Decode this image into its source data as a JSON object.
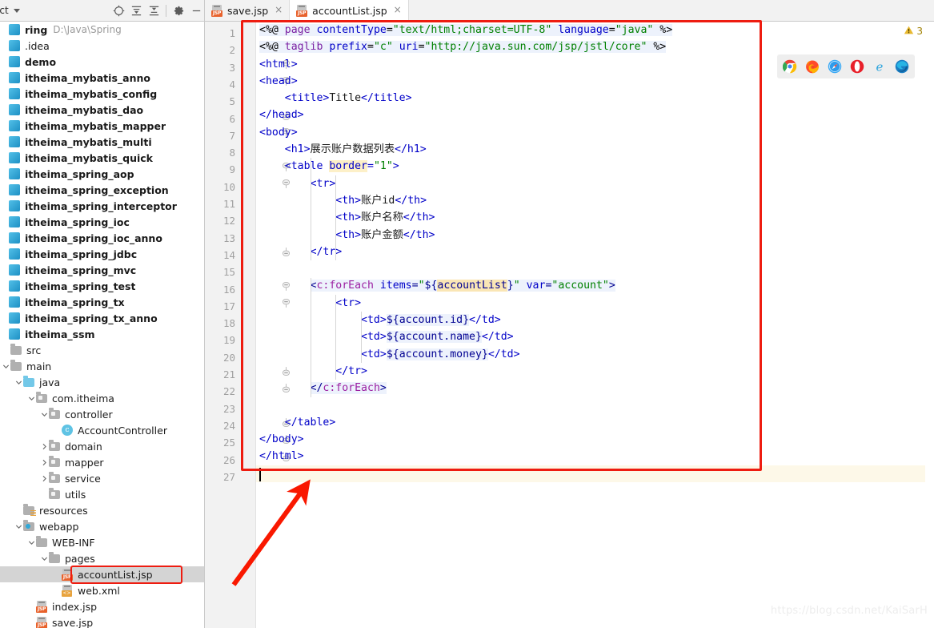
{
  "window": {
    "watermark": "https://blog.csdn.net/KaiSarH"
  },
  "project_panel": {
    "title": "ect",
    "toolbar": [
      {
        "name": "select-opened-file-icon",
        "label": "⊕"
      },
      {
        "name": "expand-all-icon",
        "label": "≣"
      },
      {
        "name": "collapse-all-icon",
        "label": "≡"
      },
      {
        "name": "settings-gear-icon",
        "label": "⚙"
      },
      {
        "name": "hide-panel-icon",
        "label": "—"
      }
    ],
    "tree": [
      {
        "depth": 0,
        "arrow": "none",
        "icon": "module",
        "label": "ring",
        "path": "D:\\Java\\Spring",
        "bold": true,
        "selected": false
      },
      {
        "depth": 0,
        "arrow": "none",
        "icon": "module",
        "label": ".idea",
        "path": "",
        "bold": false,
        "selected": false
      },
      {
        "depth": 0,
        "arrow": "none",
        "icon": "module",
        "label": "demo",
        "path": "",
        "bold": true,
        "selected": false
      },
      {
        "depth": 0,
        "arrow": "none",
        "icon": "module",
        "label": "itheima_mybatis_anno",
        "path": "",
        "bold": true,
        "selected": false
      },
      {
        "depth": 0,
        "arrow": "none",
        "icon": "module",
        "label": "itheima_mybatis_config",
        "path": "",
        "bold": true,
        "selected": false
      },
      {
        "depth": 0,
        "arrow": "none",
        "icon": "module",
        "label": "itheima_mybatis_dao",
        "path": "",
        "bold": true,
        "selected": false
      },
      {
        "depth": 0,
        "arrow": "none",
        "icon": "module",
        "label": "itheima_mybatis_mapper",
        "path": "",
        "bold": true,
        "selected": false
      },
      {
        "depth": 0,
        "arrow": "none",
        "icon": "module",
        "label": "itheima_mybatis_multi",
        "path": "",
        "bold": true,
        "selected": false
      },
      {
        "depth": 0,
        "arrow": "none",
        "icon": "module",
        "label": "itheima_mybatis_quick",
        "path": "",
        "bold": true,
        "selected": false
      },
      {
        "depth": 0,
        "arrow": "none",
        "icon": "module",
        "label": "itheima_spring_aop",
        "path": "",
        "bold": true,
        "selected": false
      },
      {
        "depth": 0,
        "arrow": "none",
        "icon": "module",
        "label": "itheima_spring_exception",
        "path": "",
        "bold": true,
        "selected": false
      },
      {
        "depth": 0,
        "arrow": "none",
        "icon": "module",
        "label": "itheima_spring_interceptor",
        "path": "",
        "bold": true,
        "selected": false
      },
      {
        "depth": 0,
        "arrow": "none",
        "icon": "module",
        "label": "itheima_spring_ioc",
        "path": "",
        "bold": true,
        "selected": false
      },
      {
        "depth": 0,
        "arrow": "none",
        "icon": "module",
        "label": "itheima_spring_ioc_anno",
        "path": "",
        "bold": true,
        "selected": false
      },
      {
        "depth": 0,
        "arrow": "none",
        "icon": "module",
        "label": "itheima_spring_jdbc",
        "path": "",
        "bold": true,
        "selected": false
      },
      {
        "depth": 0,
        "arrow": "none",
        "icon": "module",
        "label": "itheima_spring_mvc",
        "path": "",
        "bold": true,
        "selected": false
      },
      {
        "depth": 0,
        "arrow": "none",
        "icon": "module",
        "label": "itheima_spring_test",
        "path": "",
        "bold": true,
        "selected": false
      },
      {
        "depth": 0,
        "arrow": "none",
        "icon": "module",
        "label": "itheima_spring_tx",
        "path": "",
        "bold": true,
        "selected": false
      },
      {
        "depth": 0,
        "arrow": "none",
        "icon": "module",
        "label": "itheima_spring_tx_anno",
        "path": "",
        "bold": true,
        "selected": false
      },
      {
        "depth": 0,
        "arrow": "none",
        "icon": "module",
        "label": "itheima_ssm",
        "path": "",
        "bold": true,
        "selected": false
      },
      {
        "depth": 1,
        "arrow": "none",
        "icon": "folder",
        "label": "src",
        "path": "",
        "bold": false,
        "selected": false
      },
      {
        "depth": 1,
        "arrow": "down",
        "icon": "folder",
        "label": "main",
        "path": "",
        "bold": false,
        "selected": false
      },
      {
        "depth": 2,
        "arrow": "down",
        "icon": "folder-blue",
        "label": "java",
        "path": "",
        "bold": false,
        "selected": false
      },
      {
        "depth": 3,
        "arrow": "down",
        "icon": "package",
        "label": "com.itheima",
        "path": "",
        "bold": false,
        "selected": false
      },
      {
        "depth": 4,
        "arrow": "down",
        "icon": "package",
        "label": "controller",
        "path": "",
        "bold": false,
        "selected": false
      },
      {
        "depth": 5,
        "arrow": "none",
        "icon": "class",
        "label": "AccountController",
        "path": "",
        "bold": false,
        "selected": false
      },
      {
        "depth": 4,
        "arrow": "right",
        "icon": "package",
        "label": "domain",
        "path": "",
        "bold": false,
        "selected": false
      },
      {
        "depth": 4,
        "arrow": "right",
        "icon": "package",
        "label": "mapper",
        "path": "",
        "bold": false,
        "selected": false
      },
      {
        "depth": 4,
        "arrow": "right",
        "icon": "package",
        "label": "service",
        "path": "",
        "bold": false,
        "selected": false
      },
      {
        "depth": 4,
        "arrow": "none",
        "icon": "package",
        "label": "utils",
        "path": "",
        "bold": false,
        "selected": false
      },
      {
        "depth": 2,
        "arrow": "none",
        "icon": "resources",
        "label": "resources",
        "path": "",
        "bold": false,
        "selected": false
      },
      {
        "depth": 2,
        "arrow": "down",
        "icon": "webapp",
        "label": "webapp",
        "path": "",
        "bold": false,
        "selected": false
      },
      {
        "depth": 3,
        "arrow": "down",
        "icon": "folder",
        "label": "WEB-INF",
        "path": "",
        "bold": false,
        "selected": false
      },
      {
        "depth": 4,
        "arrow": "down",
        "icon": "folder",
        "label": "pages",
        "path": "",
        "bold": false,
        "selected": false
      },
      {
        "depth": 5,
        "arrow": "none",
        "icon": "jsp",
        "label": "accountList.jsp",
        "path": "",
        "bold": false,
        "selected": true
      },
      {
        "depth": 5,
        "arrow": "none",
        "icon": "xml",
        "label": "web.xml",
        "path": "",
        "bold": false,
        "selected": false
      },
      {
        "depth": 3,
        "arrow": "none",
        "icon": "jsp",
        "label": "index.jsp",
        "path": "",
        "bold": false,
        "selected": false
      },
      {
        "depth": 3,
        "arrow": "none",
        "icon": "jsp",
        "label": "save.jsp",
        "path": "",
        "bold": false,
        "selected": false
      }
    ]
  },
  "tabs": [
    {
      "label": "save.jsp",
      "icon": "jsp-file-icon",
      "active": false,
      "close": "×"
    },
    {
      "label": "accountList.jsp",
      "icon": "jsp-file-icon",
      "active": true,
      "close": "×"
    }
  ],
  "inspection": {
    "icon": "warning-triangle-icon",
    "count": "3",
    "color": "#e8b930"
  },
  "browser_strip": [
    {
      "name": "chrome-icon",
      "label": "Chrome"
    },
    {
      "name": "firefox-icon",
      "label": "Firefox"
    },
    {
      "name": "safari-icon",
      "label": "Safari"
    },
    {
      "name": "opera-icon",
      "label": "Opera"
    },
    {
      "name": "internet-explorer-icon",
      "label": "Internet Explorer"
    },
    {
      "name": "edge-icon",
      "label": "Edge"
    }
  ],
  "editor": {
    "filename": "accountList.jsp",
    "caret_line": 27,
    "total_lines": 27,
    "line_numbers": [
      "1",
      "2",
      "3",
      "4",
      "5",
      "6",
      "7",
      "8",
      "9",
      "10",
      "11",
      "12",
      "13",
      "14",
      "15",
      "16",
      "17",
      "18",
      "19",
      "20",
      "21",
      "22",
      "23",
      "24",
      "25",
      "26",
      "27"
    ],
    "code_lines": [
      "<%@ page contentType=\"text/html;charset=UTF-8\" language=\"java\" %>",
      "<%@ taglib prefix=\"c\" uri=\"http://java.sun.com/jsp/jstl/core\" %>",
      "<html>",
      "<head>",
      "    <title>Title</title>",
      "</head>",
      "<body>",
      "    <h1>展示账户数据列表</h1>",
      "    <table border=\"1\">",
      "        <tr>",
      "            <th>账户id</th>",
      "            <th>账户名称</th>",
      "            <th>账户金额</th>",
      "        </tr>",
      "",
      "        <c:forEach items=\"${accountList}\" var=\"account\">",
      "            <tr>",
      "                <td>${account.id}</td>",
      "                <td>${account.name}</td>",
      "                <td>${account.money}</td>",
      "            </tr>",
      "        </c:forEach>",
      "",
      "    </table>",
      "</body>",
      "</html>",
      ""
    ]
  },
  "annotations": {
    "code_box_color": "#ee1c10",
    "file_box_color": "#ee1c10",
    "arrow_color": "#f91800"
  }
}
